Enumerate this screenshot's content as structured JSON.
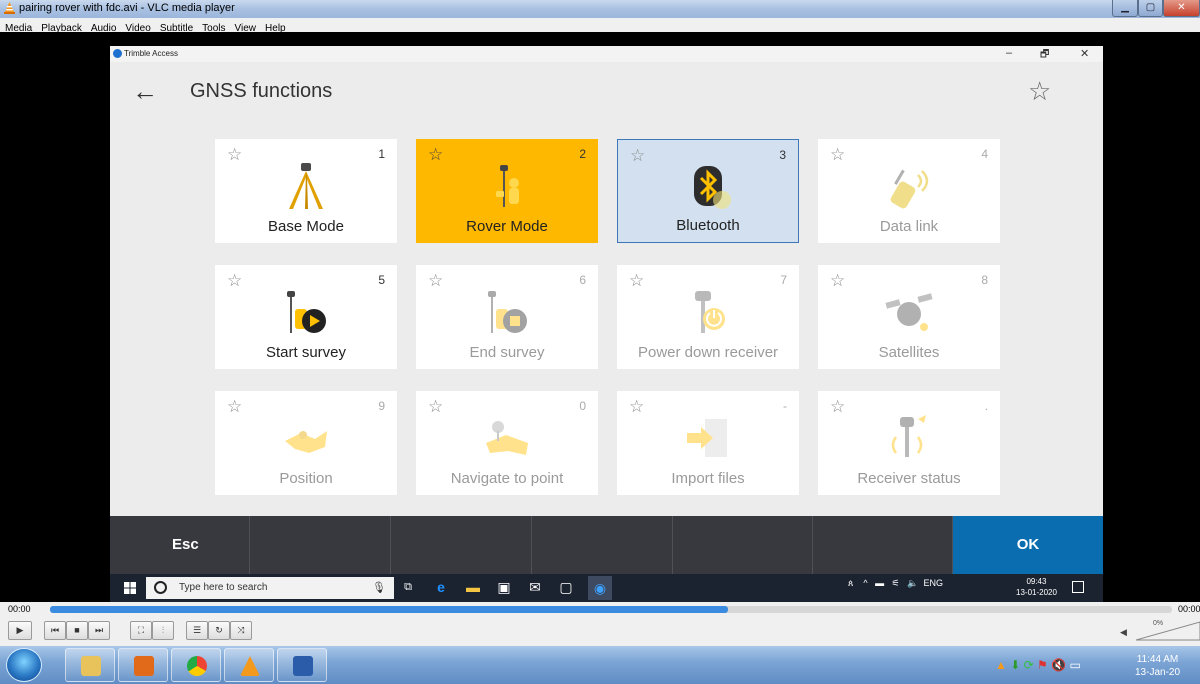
{
  "vlc": {
    "window_title": "pairing rover with fdc.avi - VLC media player",
    "menu": [
      "Media",
      "Playback",
      "Audio",
      "Video",
      "Subtitle",
      "Tools",
      "View",
      "Help"
    ],
    "time_elapsed": "00:00",
    "time_total": "00:00",
    "seek_progress": 0.604,
    "volume_label": "0%"
  },
  "trimble": {
    "app_name": "Trimble Access",
    "title": "GNSS functions",
    "window_controls": {
      "minimize": "–",
      "restore": "🗗",
      "close": "✕"
    },
    "tiles": [
      {
        "number": "1",
        "label": "Base Mode",
        "icon": "tripod-icon",
        "state": "enabled"
      },
      {
        "number": "2",
        "label": "Rover Mode",
        "icon": "rover-icon",
        "state": "active"
      },
      {
        "number": "3",
        "label": "Bluetooth",
        "icon": "bluetooth-icon",
        "state": "selected"
      },
      {
        "number": "4",
        "label": "Data link",
        "icon": "radio-icon",
        "state": "disabled"
      },
      {
        "number": "5",
        "label": "Start survey",
        "icon": "start-survey-icon",
        "state": "enabled"
      },
      {
        "number": "6",
        "label": "End survey",
        "icon": "end-survey-icon",
        "state": "disabled"
      },
      {
        "number": "7",
        "label": "Power down receiver",
        "icon": "power-icon",
        "state": "disabled"
      },
      {
        "number": "8",
        "label": "Satellites",
        "icon": "satellite-icon",
        "state": "disabled"
      },
      {
        "number": "9",
        "label": "Position",
        "icon": "position-icon",
        "state": "disabled"
      },
      {
        "number": "0",
        "label": "Navigate to point",
        "icon": "navigate-icon",
        "state": "disabled"
      },
      {
        "number": "-",
        "label": "Import files",
        "icon": "import-icon",
        "state": "disabled"
      },
      {
        "number": ".",
        "label": "Receiver status",
        "icon": "receiver-status-icon",
        "state": "disabled"
      }
    ],
    "footer": {
      "esc": "Esc",
      "ok": "OK"
    },
    "colors": {
      "active_tile": "#ffb800",
      "selected_tile": "#d2e0ef",
      "footer": "#38383f",
      "ok_button": "#0a6db0"
    }
  },
  "win10_taskbar": {
    "search_placeholder": "Type here to search",
    "tray_lang": "ENG",
    "clock_time": "09:43",
    "clock_date": "13-01-2020"
  },
  "win7_taskbar": {
    "clock_time": "11:44 AM",
    "clock_date": "13-Jan-20"
  }
}
